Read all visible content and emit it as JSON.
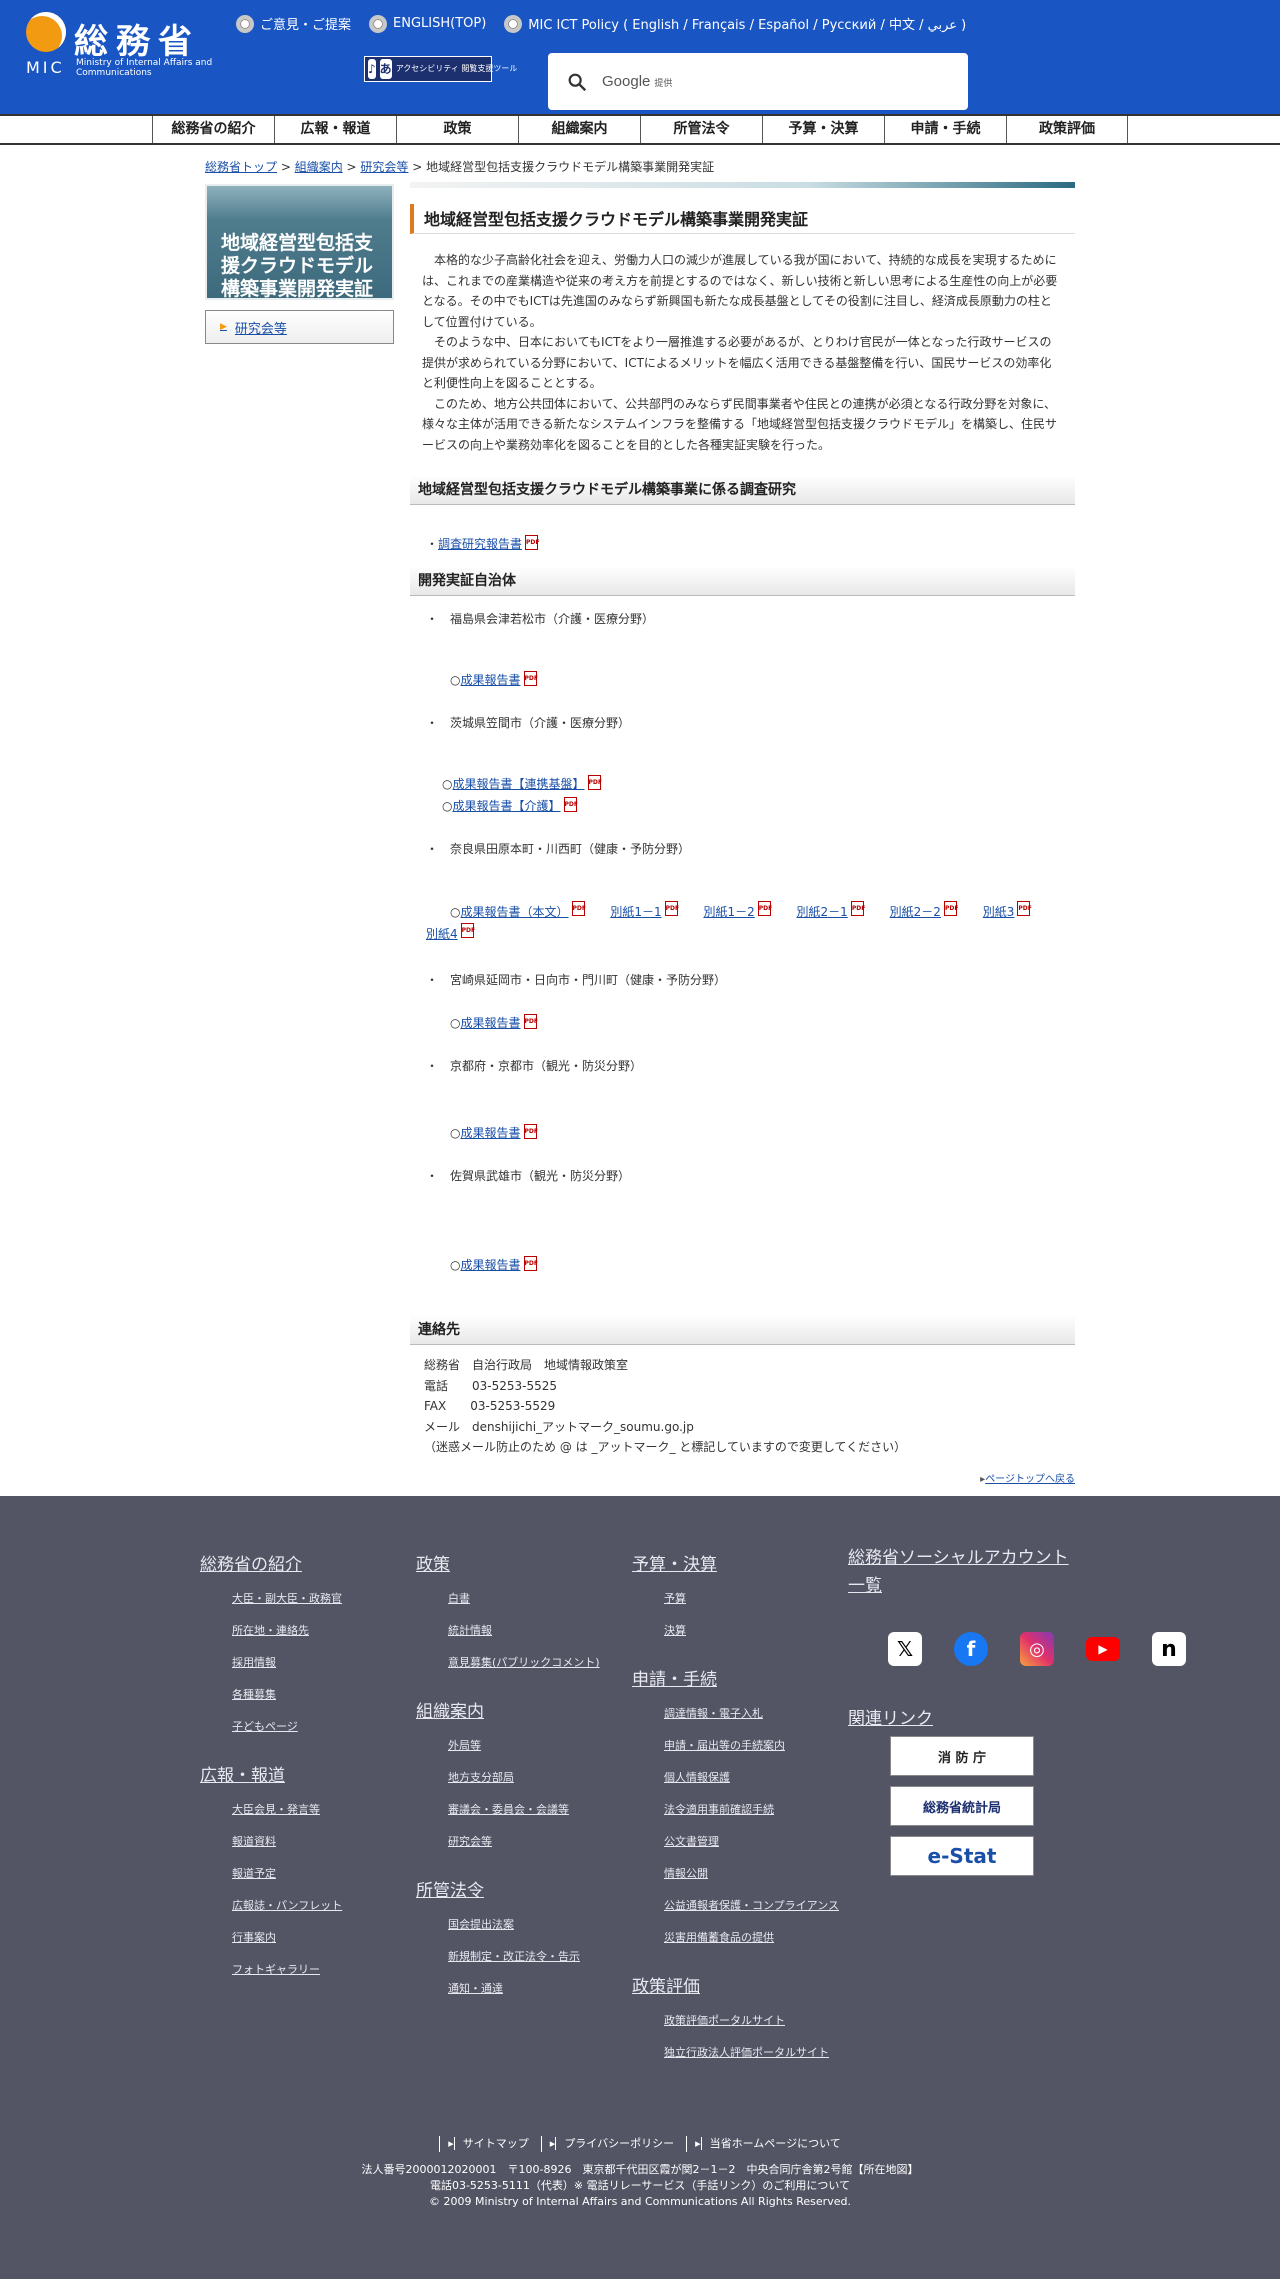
{
  "header": {
    "logo_main": "総務省",
    "logo_mic": "MIC",
    "logo_sub": "Ministry of Internal Affairs and Communications",
    "radios": [
      "ご意見・ご提案",
      "ENGLISH(TOP)",
      "MIC ICT Policy ( English / Français / Español / Pусский / 中文 / عربي )"
    ],
    "accessibility_label": "アクセシビリティ 閲覧支援ツール",
    "search_brand": "Google",
    "search_brand_suffix": "提供"
  },
  "nav": [
    "総務省の紹介",
    "広報・報道",
    "政策",
    "組織案内",
    "所管法令",
    "予算・決算",
    "申請・手続",
    "政策評価"
  ],
  "breadcrumb": {
    "links": [
      "総務省トップ",
      "組織案内",
      "研究会等"
    ],
    "sep": " > ",
    "current": "地域経営型包括支援クラウドモデル構築事業開発実証"
  },
  "sidebar": {
    "title": "地域経営型包括支援クラウドモデル構築事業開発実証",
    "link": "研究会等"
  },
  "main": {
    "title": "地域経営型包括支援クラウドモデル構築事業開発実証",
    "intro": [
      "本格的な少子高齢化社会を迎え、労働力人口の減少が進展している我が国において、持続的な成長を実現するためには、これまでの産業構造や従来の考え方を前提とするのではなく、新しい技術と新しい思考による生産性の向上が必要となる。その中でもICTは先進国のみならず新興国も新たな成長基盤としてその役割に注目し、経済成長原動力の柱として位置付けている。",
      "そのような中、日本においてもICTをより一層推進する必要があるが、とりわけ官民が一体となった行政サービスの提供が求められている分野において、ICTによるメリットを幅広く活用できる基盤整備を行い、国民サービスの効率化と利便性向上を図ることとする。",
      "このため、地方公共団体において、公共部門のみならず民間事業者や住民との連携が必須となる行政分野を対象に、様々な主体が活用できる新たなシステムインフラを整備する「地域経営型包括支援クラウドモデル」を構築し、住民サービスの向上や業務効率化を図ることを目的とした各種実証実験を行った。"
    ],
    "section1_title": "地域経営型包括支援クラウドモデル構築事業に係る調査研究",
    "section1_link": "調査研究報告書",
    "section2_title": "開発実証自治体",
    "municipalities": [
      {
        "name": "福島県会津若松市（介護・医療分野）",
        "links": [
          "成果報告書"
        ]
      },
      {
        "name": "茨城県笠間市（介護・医療分野）",
        "links": [
          "成果報告書【連携基盤】",
          "成果報告書【介護】"
        ]
      },
      {
        "name": "奈良県田原本町・川西町（健康・予防分野）",
        "links": [
          "成果報告書（本文）",
          "別紙1－1",
          "別紙1－2",
          "別紙2－1",
          "別紙2－2",
          "別紙3",
          "別紙4"
        ]
      },
      {
        "name": "宮崎県延岡市・日向市・門川町（健康・予防分野）",
        "links": [
          "成果報告書"
        ]
      },
      {
        "name": "京都府・京都市（観光・防災分野）",
        "links": [
          "成果報告書"
        ]
      },
      {
        "name": "佐賀県武雄市（観光・防災分野）",
        "links": [
          "成果報告書"
        ]
      }
    ],
    "contact_title": "連絡先",
    "contact": {
      "org": "総務省　自治行政局　地域情報政策室",
      "tel_label": "電話",
      "tel": "03-5253-5525",
      "fax_label": "FAX",
      "fax": "03-5253-5529",
      "mail_label": "メール",
      "mail": "denshijichi_アットマーク_soumu.go.jp",
      "note": "（迷惑メール防止のため @ は _アットマーク_ と標記していますので変更してください）"
    },
    "page_top": "ページトップへ戻る"
  },
  "footer": {
    "col1": [
      {
        "title": "総務省の紹介",
        "links": [
          "大臣・副大臣・政務官",
          "所在地・連絡先",
          "採用情報",
          "各種募集",
          "子どもページ"
        ]
      },
      {
        "title": "広報・報道",
        "links": [
          "大臣会見・発言等",
          "報道資料",
          "報道予定",
          "広報誌・パンフレット",
          "行事案内",
          "フォトギャラリー"
        ]
      }
    ],
    "col2": [
      {
        "title": "政策",
        "links": [
          "白書",
          "統計情報",
          "意見募集(パブリックコメント)"
        ]
      },
      {
        "title": "組織案内",
        "links": [
          "外局等",
          "地方支分部局",
          "審議会・委員会・会議等",
          "研究会等"
        ]
      },
      {
        "title": "所管法令",
        "links": [
          "国会提出法案",
          "新規制定・改正法令・告示",
          "通知・通達"
        ]
      }
    ],
    "col3": [
      {
        "title": "予算・決算",
        "links": [
          "予算",
          "決算"
        ]
      },
      {
        "title": "申請・手続",
        "links": [
          "調達情報・電子入札",
          "申請・届出等の手続案内",
          "個人情報保護",
          "法令適用事前確認手続",
          "公文書管理",
          "情報公開",
          "公益通報者保護・コンプライアンス",
          "災害用備蓄食品の提供"
        ]
      },
      {
        "title": "政策評価",
        "links": [
          "政策評価ポータルサイト",
          "独立行政法人評価ポータルサイト"
        ]
      }
    ],
    "social_title": "総務省ソーシャルアカウント一覧",
    "related_title": "関連リンク",
    "banners": [
      "消 防 庁",
      "総務省統計局",
      "e-Stat"
    ],
    "bottom_links": [
      "サイトマップ",
      "プライバシーポリシー",
      "当省ホームページについて"
    ],
    "address": "法人番号2000012020001　〒100-8926　東京都千代田区霞が関2－1－2　中央合同庁舎第2号館【所在地図】",
    "phone": "電話03-5253-5111（代表）※ 電話リレーサービス（手話リンク）のご利用について",
    "copyright": "© 2009 Ministry of Internal Affairs and Communications All Rights Reserved."
  }
}
